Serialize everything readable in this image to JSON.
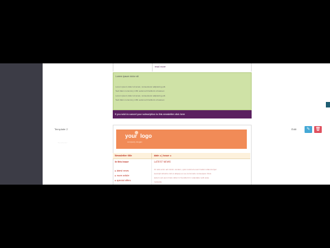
{
  "previous_template": {
    "read_more": "read more",
    "green_block": {
      "title": "Lorem ipsum dolor sit",
      "lines": [
        "Lorem ipsum dolor sit amet, consectetur adipiscing elit.",
        "Sed diam nonummy nibh euismod tincidunt ut laoreet.",
        "Lorem ipsum dolor sit amet, consectetur adipiscing elit.",
        "Sed diam nonummy nibh euismod tincidunt ut laoreet."
      ]
    },
    "unsubscribe_text": "If you wish to cancel your subscription to this newsletter click here"
  },
  "template_row": {
    "label": "Template 2",
    "sub_label": "Newsletter",
    "edit_link": "Edit",
    "edit_icon": "pencil-icon",
    "delete_icon": "trash-icon",
    "edit_color": "#45a9d6",
    "delete_color": "#e0515f"
  },
  "template_preview": {
    "logo_your": "your",
    "logo_logo": "logo",
    "logo_tagline": "company slogan",
    "header_color": "#f18b57",
    "newsletter_title": "Newsletter title",
    "date_line": "date ● | issue ●",
    "in_this_issue": "In this issue",
    "issue_items": [
      "▸ latest news",
      "▸ more article",
      "▸ special offers"
    ],
    "latest_news": "LATEST NEWS",
    "news_lines": [
      "Ut wisi enim ad minim veniam, quis nostrud exerci tation ullamcorper",
      "suscipit lobortis nisl ut aliquip ex ea commodo consequat. Duis",
      "autem vel eum iriure dolor in hendrerit in vulputate velit esse",
      "molestie."
    ]
  }
}
